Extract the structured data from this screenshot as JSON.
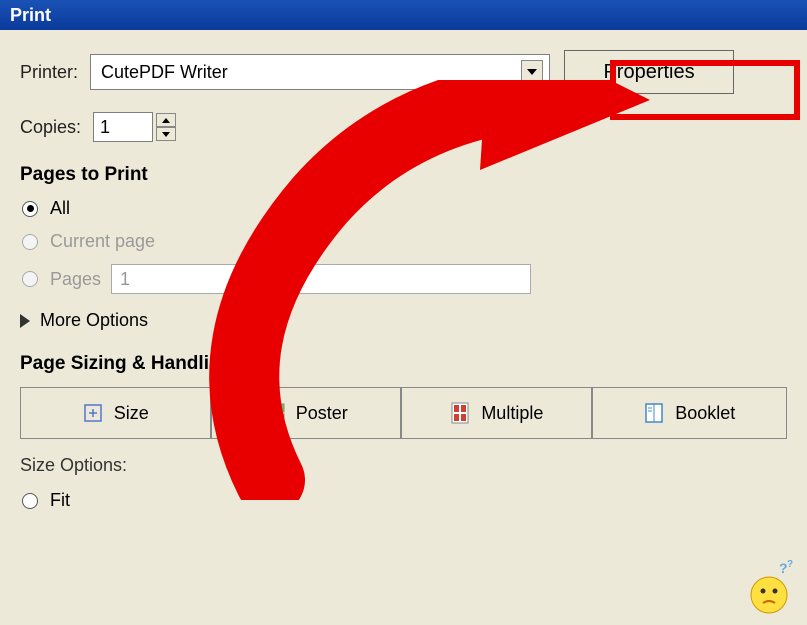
{
  "window": {
    "title": "Print"
  },
  "printer": {
    "label": "Printer:",
    "selected": "CutePDF Writer",
    "properties_label": "Properties"
  },
  "copies": {
    "label": "Copies:",
    "value": "1"
  },
  "pages_to_print": {
    "heading": "Pages to Print",
    "all_label": "All",
    "current_page_label": "Current page",
    "pages_label": "Pages",
    "pages_value": "1",
    "more_options_label": "More Options"
  },
  "sizing": {
    "heading": "Page Sizing & Handling",
    "size_label": "Size",
    "poster_label": "Poster",
    "multiple_label": "Multiple",
    "booklet_label": "Booklet"
  },
  "size_options": {
    "heading": "Size Options:",
    "fit_label": "Fit"
  },
  "annotation": {
    "arrow_color": "#e80000",
    "highlight_box": "properties-button"
  }
}
